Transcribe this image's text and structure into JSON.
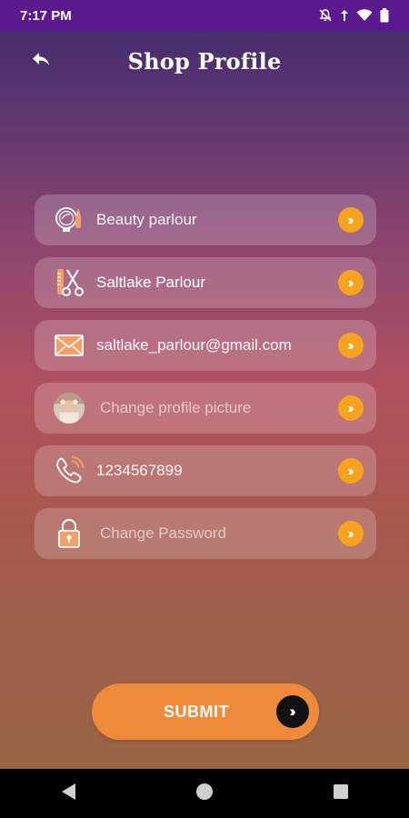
{
  "status_bar": {
    "time": "7:17 PM",
    "icons": [
      "notifications-off-icon",
      "signal-icon",
      "wifi-icon",
      "battery-icon"
    ]
  },
  "header": {
    "title": "Shop Profile",
    "back_icon": "back-arrow-icon"
  },
  "fields": [
    {
      "name": "category-field",
      "icon": "beauty-mirror-icon",
      "value": "Beauty parlour"
    },
    {
      "name": "shop-name-field",
      "icon": "scissors-comb-icon",
      "value": "Saltlake Parlour"
    },
    {
      "name": "email-field",
      "icon": "envelope-icon",
      "value": "saltlake_parlour@gmail.com"
    },
    {
      "name": "profile-picture-field",
      "icon": "profile-avatar-icon",
      "value": "Change profile picture"
    },
    {
      "name": "phone-field",
      "icon": "phone-icon",
      "value": "1234567899"
    },
    {
      "name": "password-field",
      "icon": "lock-icon",
      "value": "Change Password"
    }
  ],
  "submit": {
    "label": "SUBMIT",
    "icon": "double-chevron-right-icon"
  },
  "nav": {
    "icons": [
      "back-triangle-icon",
      "home-circle-icon",
      "recents-square-icon"
    ]
  },
  "colors": {
    "status_bar": "#5b1a8e",
    "accent_orange": "#f6a31e",
    "submit_orange": "#ef8a3a"
  }
}
